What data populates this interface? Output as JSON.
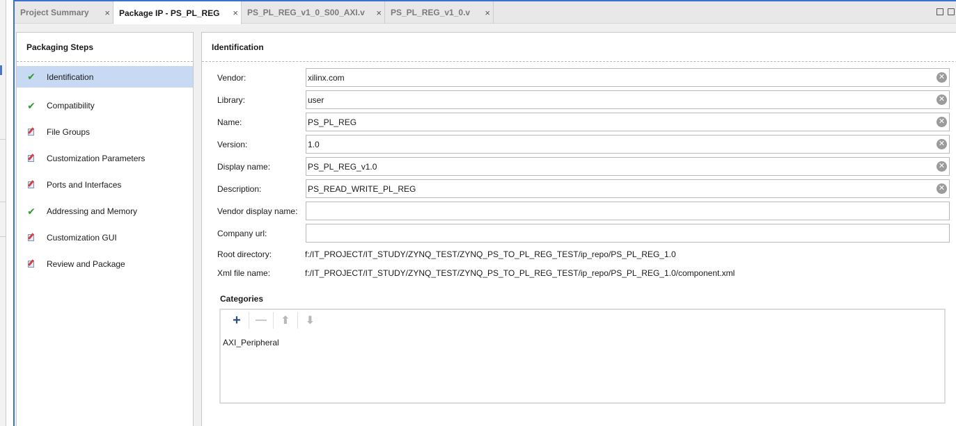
{
  "tabs": [
    {
      "label": "Project Summary"
    },
    {
      "label": "Package IP - PS_PL_REG"
    },
    {
      "label": "PS_PL_REG_v1_0_S00_AXI.v"
    },
    {
      "label": "PS_PL_REG_v1_0.v"
    }
  ],
  "close_glyph": "×",
  "steps_panel": {
    "title": "Packaging Steps",
    "steps": [
      {
        "label": "Identification",
        "icon": "check-icon",
        "icon_glyph": "✔",
        "selected": true
      },
      {
        "label": "Compatibility",
        "icon": "check-icon",
        "icon_glyph": "✔"
      },
      {
        "label": "File Groups",
        "icon": "pencil-icon"
      },
      {
        "label": "Customization Parameters",
        "icon": "pencil-icon"
      },
      {
        "label": "Ports and Interfaces",
        "icon": "pencil-icon"
      },
      {
        "label": "Addressing and Memory",
        "icon": "check-icon",
        "icon_glyph": "✔"
      },
      {
        "label": "Customization GUI",
        "icon": "pencil-icon"
      },
      {
        "label": "Review and Package",
        "icon": "pencil-icon"
      }
    ]
  },
  "identification": {
    "title": "Identification",
    "fields": [
      {
        "label": "Vendor:",
        "value": "xilinx.com",
        "clearable": true
      },
      {
        "label": "Library:",
        "value": "user",
        "clearable": true
      },
      {
        "label": "Name:",
        "value": "PS_PL_REG",
        "clearable": true
      },
      {
        "label": "Version:",
        "value": "1.0",
        "clearable": true
      },
      {
        "label": "Display name:",
        "value": "PS_PL_REG_v1.0",
        "clearable": true
      },
      {
        "label": "Description:",
        "value": "PS_READ_WRITE_PL_REG",
        "clearable": true
      },
      {
        "label": "Vendor display name:",
        "value": "",
        "clearable": false
      },
      {
        "label": "Company url:",
        "value": "",
        "clearable": false
      }
    ],
    "clear_glyph": "✕",
    "root_directory": {
      "label": "Root directory:",
      "value": "f:/IT_PROJECT/IT_STUDY/ZYNQ_TEST/ZYNQ_PS_TO_PL_REG_TEST/ip_repo/PS_PL_REG_1.0"
    },
    "xml_file_name": {
      "label": "Xml file name:",
      "value": "f:/IT_PROJECT/IT_STUDY/ZYNQ_TEST/ZYNQ_PS_TO_PL_REG_TEST/ip_repo/PS_PL_REG_1.0/component.xml"
    }
  },
  "categories": {
    "title": "Categories",
    "tools": [
      {
        "name": "add-button",
        "glyph": "+",
        "enabled": true
      },
      {
        "name": "remove-button",
        "glyph": "—",
        "enabled": false
      },
      {
        "name": "move-up-button",
        "glyph": "⬆",
        "enabled": false
      },
      {
        "name": "move-down-button",
        "glyph": "⬇",
        "enabled": false
      }
    ],
    "items": [
      "AXI_Peripheral"
    ]
  },
  "colors": {
    "accent": "#3c6fd1",
    "selected_row": "#c8daf3",
    "check": "#2f9a2f"
  }
}
